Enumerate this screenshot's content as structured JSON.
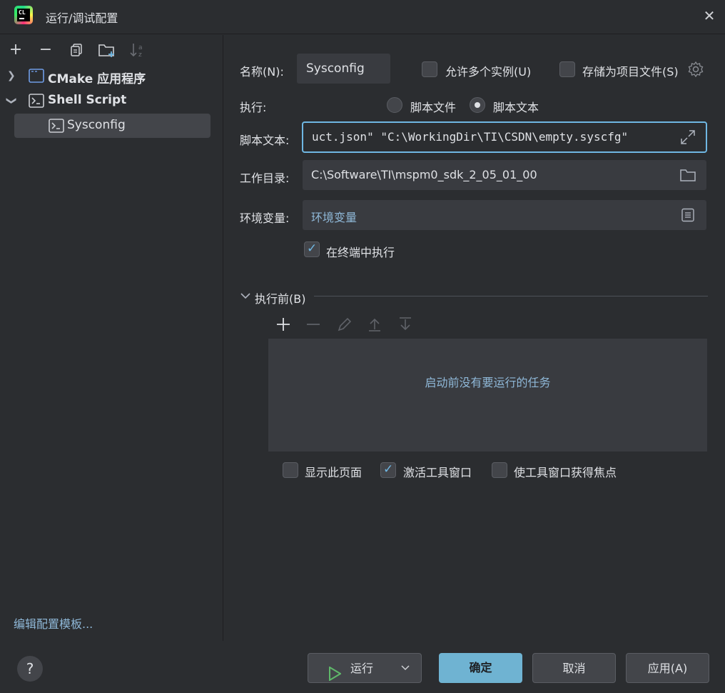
{
  "window": {
    "title": "运行/调试配置",
    "app_logo_text": "CL"
  },
  "left_toolbar": {
    "add": "+",
    "remove": "−",
    "copy": "⧉",
    "folder": "📁",
    "sort": "↓"
  },
  "tree": [
    {
      "label": "CMake 应用程序",
      "expanded": false
    },
    {
      "label": "Shell Script",
      "expanded": true,
      "children": [
        {
          "label": "Sysconfig",
          "selected": true
        }
      ]
    }
  ],
  "edit_template_link": "编辑配置模板...",
  "form": {
    "name_label": "名称(N):",
    "name_value": "Sysconfig",
    "allow_multiple_label": "允许多个实例(U)",
    "allow_multiple_checked": false,
    "store_as_file_label": "存储为项目文件(S)",
    "store_as_file_checked": false,
    "execute_label": "执行:",
    "radio_script_file": "脚本文件",
    "radio_script_text": "脚本文本",
    "selected_radio": "脚本文本",
    "script_text_label": "脚本文本:",
    "script_text_value": "uct.json\" \"C:\\WorkingDir\\TI\\CSDN\\empty.syscfg\"",
    "workdir_label": "工作目录:",
    "workdir_value": "C:\\Software\\TI\\mspm0_sdk_2_05_01_00",
    "env_label": "环境变量:",
    "env_placeholder": "环境变量",
    "run_in_terminal_label": "在终端中执行",
    "run_in_terminal_checked": true
  },
  "before_launch": {
    "section_label": "执行前(B)",
    "empty_message": "启动前没有要运行的任务",
    "show_page_label": "显示此页面",
    "show_page_checked": false,
    "activate_tool_window_label": "激活工具窗口",
    "activate_tool_window_checked": true,
    "focus_tool_window_label": "使工具窗口获得焦点",
    "focus_tool_window_checked": false
  },
  "buttons": {
    "help": "?",
    "run": "运行",
    "ok": "确定",
    "cancel": "取消",
    "apply": "应用(A)"
  },
  "colors": {
    "accent": "#6fb7e3",
    "primary_button": "#6fb3d2",
    "background": "#2b2d30",
    "link": "#8fb8d8"
  }
}
